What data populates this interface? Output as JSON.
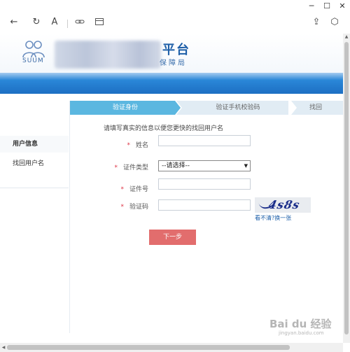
{
  "window": {
    "minimize_glyph": "─",
    "maximize_glyph": "☐",
    "close_glyph": "✕"
  },
  "toolbar": {
    "back_glyph": "←",
    "refresh_glyph": "↻",
    "reading_glyph": "A",
    "share_glyph": "⇪",
    "extension_glyph": "⬡"
  },
  "header": {
    "logo_text": "SUUM",
    "site_title": "平台",
    "site_subtitle": "保障局"
  },
  "sidebar": {
    "items": [
      {
        "label": "用户信息"
      },
      {
        "label": "找回用户名"
      }
    ]
  },
  "steps": [
    {
      "label": "验证身份"
    },
    {
      "label": "验证手机校验码"
    },
    {
      "label": "找回"
    }
  ],
  "form": {
    "intro": "请填写真实的信息以便您更快的找回用户名",
    "required_mark": "*",
    "name_label": "姓名",
    "name_value": "",
    "id_type_label": "证件类型",
    "id_type_selected": "--请选择--",
    "id_number_label": "证件号",
    "id_number_value": "",
    "captcha_label": "验证码",
    "captcha_value": "",
    "captcha_image_text": "4s8s",
    "captcha_refresh": "看不清?换一张",
    "next_button": "下一步"
  },
  "watermark": {
    "text": "Bai du 经验",
    "sub": "jingyan.baidu.com"
  }
}
